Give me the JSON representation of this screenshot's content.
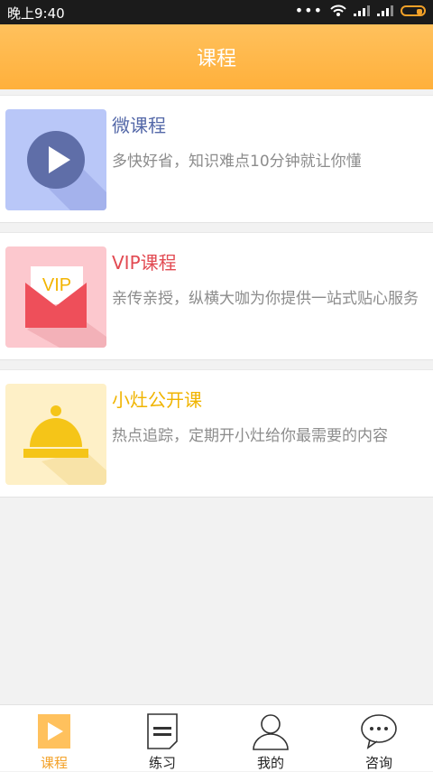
{
  "status_bar": {
    "time": "晚上9:40",
    "dots": "•••"
  },
  "header": {
    "title": "课程"
  },
  "courses": [
    {
      "name": "微课程",
      "desc": "多快好省，知识难点10分钟就让你懂",
      "name_color": "#5468a8",
      "icon": "play-icon"
    },
    {
      "name": "VIP课程",
      "desc": "亲传亲授，纵横大咖为你提供一站式贴心服务",
      "name_color": "#e24a52",
      "icon": "vip-envelope-icon",
      "icon_text": "VIP"
    },
    {
      "name": "小灶公开课",
      "desc": "热点追踪，定期开小灶给你最需要的内容",
      "name_color": "#f0b400",
      "icon": "service-bell-icon"
    }
  ],
  "tabs": [
    {
      "label": "课程",
      "icon": "play-icon",
      "active": true
    },
    {
      "label": "练习",
      "icon": "document-icon",
      "active": false
    },
    {
      "label": "我的",
      "icon": "user-icon",
      "active": false
    },
    {
      "label": "咨询",
      "icon": "chat-bubble-icon",
      "active": false
    }
  ],
  "colors": {
    "accent": "#f3a128",
    "header": "#ffb03b"
  }
}
